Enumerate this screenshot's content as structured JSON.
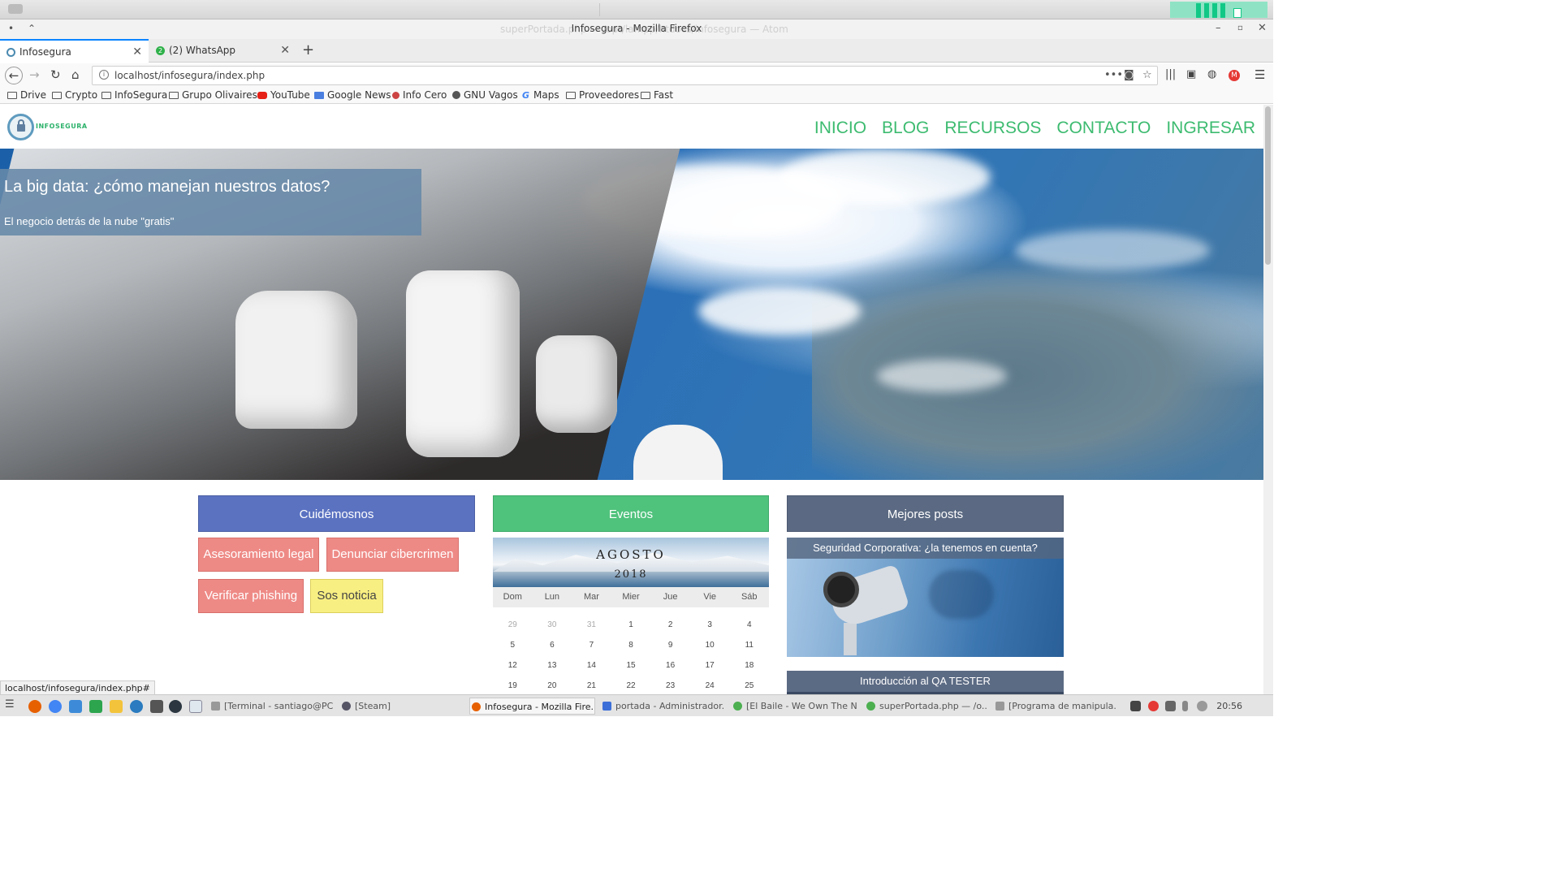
{
  "desktop": {
    "top_menu_icon": "window-menu-icon"
  },
  "window": {
    "title": "Infosegura - Mozilla Firefox",
    "ghost_title": "superPortada.php — /opt/lampp/htdocs/infosegura — Atom"
  },
  "tabs": [
    {
      "label": "Infosegura",
      "active": true
    },
    {
      "label": "(2) WhatsApp",
      "active": false,
      "badge": "2"
    }
  ],
  "urlbar": {
    "url": "localhost/infosegura/index.php"
  },
  "bookmarks": [
    "Drive",
    "Crypto",
    "InfoSegura",
    "Grupo Olivaires",
    "YouTube",
    "Google News",
    "Info Cero",
    "GNU Vagos",
    "Maps",
    "Proveedores",
    "Fast"
  ],
  "site": {
    "logo_text": "INFOSEGURA",
    "nav": [
      "INICIO",
      "BLOG",
      "RECURSOS",
      "CONTACTO",
      "INGRESAR"
    ],
    "hero": {
      "title": "La big data: ¿cómo manejan nuestros datos?",
      "subtitle": "El negocio detrás de la nube \"gratis\""
    },
    "columns": {
      "care": {
        "heading": "Cuidémosnos",
        "buttons": [
          "Asesoramiento legal",
          "Denunciar cibercrimen",
          "Verificar phishing",
          "Sos noticia"
        ]
      },
      "events": {
        "heading": "Eventos",
        "month": "AGOSTO",
        "year": "2018",
        "weekdays": [
          "Dom",
          "Lun",
          "Mar",
          "Mier",
          "Jue",
          "Vie",
          "Sáb"
        ],
        "weeks": [
          [
            "29",
            "30",
            "31",
            "1",
            "2",
            "3",
            "4"
          ],
          [
            "5",
            "6",
            "7",
            "8",
            "9",
            "10",
            "11"
          ],
          [
            "12",
            "13",
            "14",
            "15",
            "16",
            "17",
            "18"
          ],
          [
            "19",
            "20",
            "21",
            "22",
            "23",
            "24",
            "25"
          ]
        ]
      },
      "posts": {
        "heading": "Mejores posts",
        "items": [
          "Seguridad Corporativa: ¿la tenemos en cuenta?",
          "Introducción al QA TESTER"
        ]
      }
    }
  },
  "status_link": "localhost/infosegura/index.php#",
  "taskbar": {
    "tasks": [
      "[Terminal - santiago@PC...",
      "[Steam]",
      "Infosegura - Mozilla Fire...",
      "portada - Administrador...",
      "[El Baile - We Own The N...",
      "superPortada.php — /o...",
      "[Programa de manipula..."
    ],
    "clock": "20:56"
  },
  "colors": {
    "nav_green": "#3dbb70",
    "care_blue": "#5b72c1",
    "events_green": "#4fc27c",
    "posts_slate": "#5b6a82",
    "pill_red": "#ee8a86",
    "pill_yellow": "#f8ef82"
  }
}
